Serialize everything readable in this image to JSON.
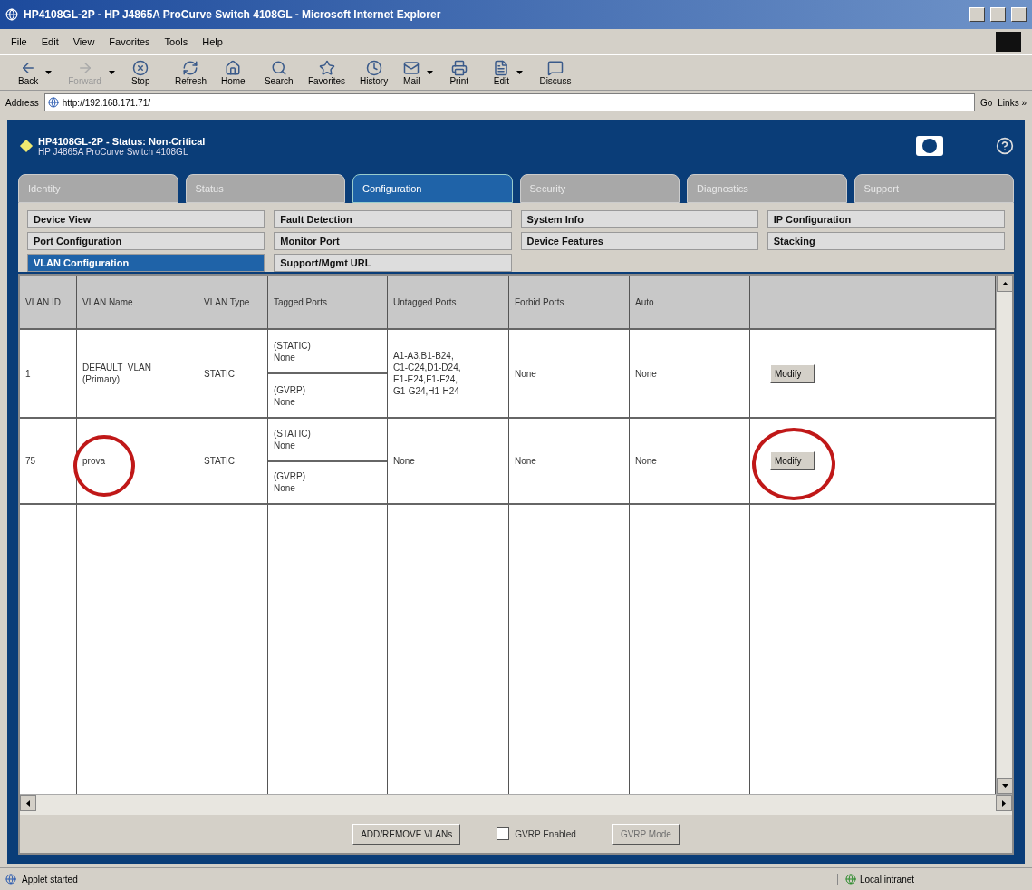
{
  "window": {
    "title": "HP4108GL-2P - HP J4865A ProCurve Switch 4108GL - Microsoft Internet Explorer"
  },
  "menu": [
    "File",
    "Edit",
    "View",
    "Favorites",
    "Tools",
    "Help"
  ],
  "toolbar": [
    {
      "label": "Back",
      "disabled": false,
      "dropdown": true
    },
    {
      "label": "Forward",
      "disabled": true,
      "dropdown": true
    },
    {
      "label": "Stop",
      "disabled": false,
      "dropdown": false
    },
    {
      "label": "Refresh",
      "disabled": false,
      "dropdown": false
    },
    {
      "label": "Home",
      "disabled": false,
      "dropdown": false
    },
    {
      "label": "Search",
      "disabled": false,
      "dropdown": false
    },
    {
      "label": "Favorites",
      "disabled": false,
      "dropdown": false
    },
    {
      "label": "History",
      "disabled": false,
      "dropdown": false
    },
    {
      "label": "Mail",
      "disabled": false,
      "dropdown": true
    },
    {
      "label": "Print",
      "disabled": false,
      "dropdown": false
    },
    {
      "label": "Edit",
      "disabled": false,
      "dropdown": true
    },
    {
      "label": "Discuss",
      "disabled": false,
      "dropdown": false
    }
  ],
  "address": {
    "label": "Address",
    "value": "http://192.168.171.71/",
    "go": "Go",
    "links": "Links »"
  },
  "header": {
    "title": "HP4108GL-2P - Status: Non-Critical",
    "subtitle": "HP J4865A ProCurve Switch 4108GL"
  },
  "tabs": [
    {
      "label": "Identity",
      "selected": false
    },
    {
      "label": "Status",
      "selected": false
    },
    {
      "label": "Configuration",
      "selected": true
    },
    {
      "label": "Security",
      "selected": false
    },
    {
      "label": "Diagnostics",
      "selected": false
    },
    {
      "label": "Support",
      "selected": false
    }
  ],
  "subnav": [
    {
      "label": "Device View",
      "selected": false
    },
    {
      "label": "Fault Detection",
      "selected": false
    },
    {
      "label": "System Info",
      "selected": false
    },
    {
      "label": "IP Configuration",
      "selected": false
    },
    {
      "label": "Port Configuration",
      "selected": false
    },
    {
      "label": "Monitor Port",
      "selected": false
    },
    {
      "label": "Device Features",
      "selected": false
    },
    {
      "label": "Stacking",
      "selected": false
    },
    {
      "label": "VLAN Configuration",
      "selected": true
    },
    {
      "label": "Support/Mgmt URL",
      "selected": false
    }
  ],
  "table": {
    "columns": [
      "VLAN ID",
      "VLAN Name",
      "VLAN Type",
      "Tagged Ports",
      "Untagged Ports",
      "Forbid Ports",
      "Auto"
    ],
    "rows": [
      {
        "id": "1",
        "name": [
          "DEFAULT_VLAN",
          "(Primary)"
        ],
        "name_circled": false,
        "type": "STATIC",
        "tagged": [
          [
            "(STATIC)",
            "None"
          ],
          [
            "(GVRP)",
            "None"
          ]
        ],
        "untagged": [
          "A1-A3,B1-B24,",
          "C1-C24,D1-D24,",
          "E1-E24,F1-F24,",
          "G1-G24,H1-H24"
        ],
        "forbid": "None",
        "auto": "None",
        "action": "Modify",
        "action_circled": false
      },
      {
        "id": "75",
        "name": [
          "prova"
        ],
        "name_circled": true,
        "type": "STATIC",
        "tagged": [
          [
            "(STATIC)",
            "None"
          ],
          [
            "(GVRP)",
            "None"
          ]
        ],
        "untagged": [
          "None"
        ],
        "forbid": "None",
        "auto": "None",
        "action": "Modify",
        "action_circled": true
      }
    ]
  },
  "footer": {
    "add_button": "ADD/REMOVE VLANs",
    "gvrp": {
      "label": "GVRP Enabled",
      "checked": false
    },
    "mode_button": {
      "label": "GVRP Mode",
      "disabled": true
    }
  },
  "status_bar": {
    "text": "Applet started",
    "zone": "Local intranet"
  }
}
